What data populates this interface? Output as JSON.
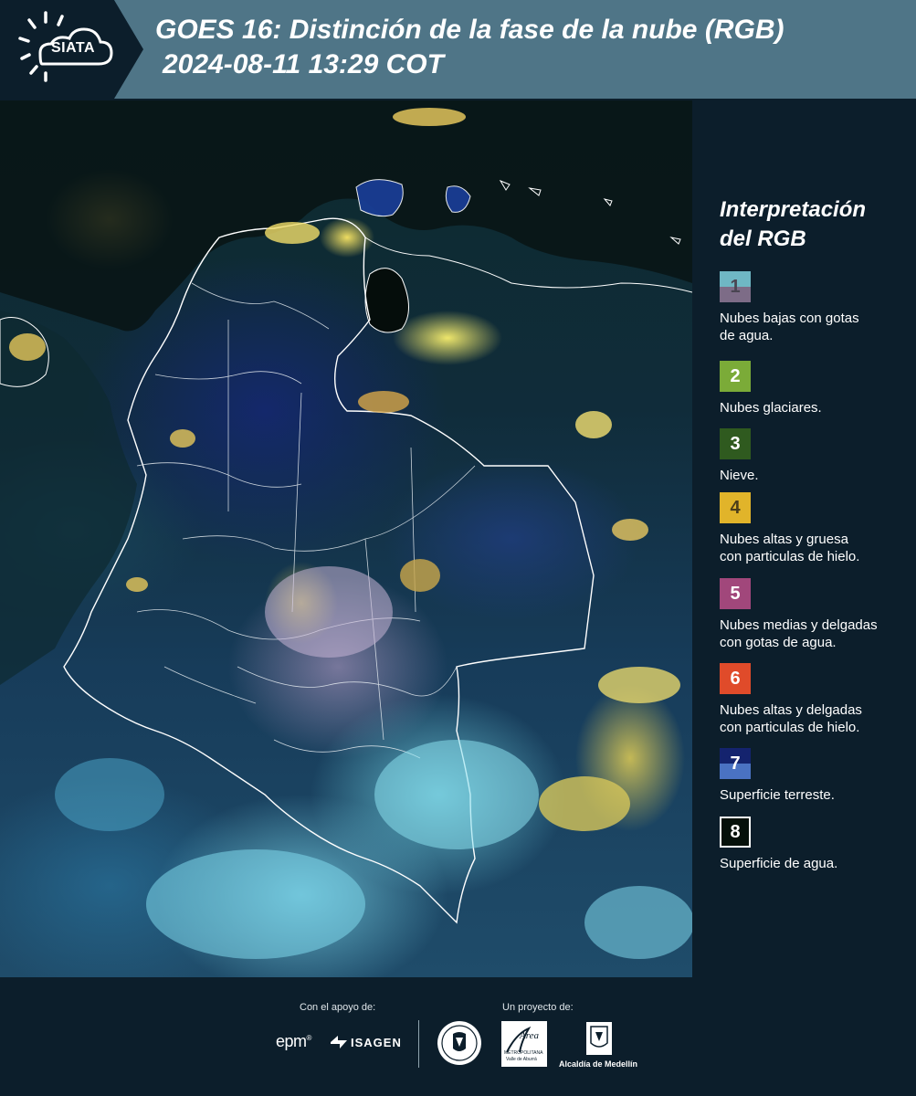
{
  "header": {
    "logo_text": "SIATA",
    "title_line1": "GOES 16: Distinción de la fase de la nube (RGB)",
    "title_line2": "2024-08-11 13:29 COT",
    "background_color": "#4f7587"
  },
  "map": {
    "content": "satellite-rgb-cloud-phase-image"
  },
  "legend": {
    "title_line1": "Interpretación",
    "title_line2": "del RGB",
    "items": [
      {
        "number": "1",
        "label_line1": "Nubes bajas con gotas",
        "label_line2": "de agua.",
        "color_top": "#6fb7c4",
        "color_bottom": "#7d6c87",
        "number_color": "#4a4552"
      },
      {
        "number": "2",
        "label_line1": "Nubes glaciares.",
        "label_line2": "",
        "color_top": "#7bab38",
        "color_bottom": "#7bab38",
        "number_color": "#ffffff"
      },
      {
        "number": "3",
        "label_line1": "Nieve.",
        "label_line2": "",
        "color_top": "#2f5a1f",
        "color_bottom": "#2f5a1f",
        "number_color": "#ffffff"
      },
      {
        "number": "4",
        "label_line1": "Nubes altas y gruesa",
        "label_line2": "con particulas de hielo.",
        "color_top": "#e1b42a",
        "color_bottom": "#e1b42a",
        "number_color": "#4a3d1a"
      },
      {
        "number": "5",
        "label_line1": "Nubes medias y delgadas",
        "label_line2": "con gotas de agua.",
        "color_top": "#a1477b",
        "color_bottom": "#a1477b",
        "number_color": "#ffffff"
      },
      {
        "number": "6",
        "label_line1": "Nubes altas y delgadas",
        "label_line2": "con particulas de hielo.",
        "color_top": "#e04b2a",
        "color_bottom": "#e04b2a",
        "number_color": "#ffffff"
      },
      {
        "number": "7",
        "label_line1": "Superficie terreste.",
        "label_line2": "",
        "color_top": "#14236e",
        "color_bottom": "#4a72c2",
        "number_color": "#ffffff"
      },
      {
        "number": "8",
        "label_line1": "Superficie de agua.",
        "label_line2": "",
        "color_top": "#05100a",
        "color_bottom": "#05100a",
        "number_color": "#ffffff"
      }
    ]
  },
  "footer": {
    "support_label": "Con el apoyo de:",
    "project_label": "Un proyecto de:",
    "sponsor_1": "epm",
    "sponsor_2": "ISAGEN",
    "partner_1_top": "Área",
    "partner_1_sub": "METROPOLITANA",
    "partner_1_sub2": "Valle de Aburrá",
    "partner_2": "Alcaldía de Medellín"
  }
}
